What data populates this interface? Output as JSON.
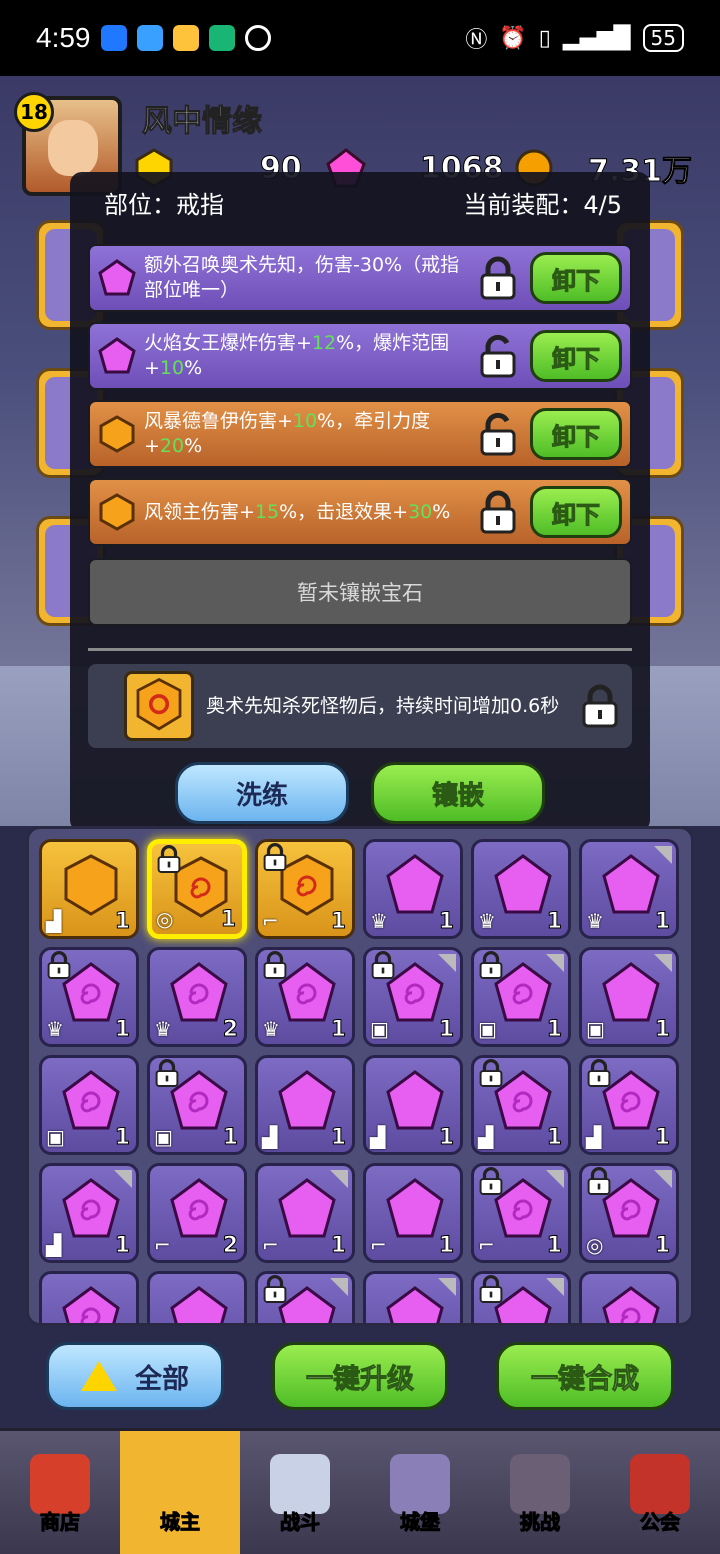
{
  "status_bar": {
    "time": "4:59",
    "battery": "55"
  },
  "header": {
    "player_level": "18",
    "player_name": "风中情缘",
    "gold": "90",
    "diamond": "1068",
    "coins": "7.31万"
  },
  "dialog": {
    "slot_label": "部位：戒指",
    "equip_label": "当前装配：4/5",
    "slots": [
      {
        "type": "purple",
        "text_parts": [
          "额外召唤奥术先知，伤害-30%（戒指部位唯一）"
        ],
        "locked": true,
        "button": "卸下"
      },
      {
        "type": "purple",
        "text_parts": [
          "火焰女王爆炸伤害+",
          "12",
          "%，爆炸范围+",
          "10",
          "%"
        ],
        "locked": false,
        "button": "卸下"
      },
      {
        "type": "orange",
        "text_parts": [
          "风暴德鲁伊伤害+",
          "10",
          "%，牵引力度+",
          "20",
          "%"
        ],
        "locked": false,
        "button": "卸下"
      },
      {
        "type": "orange",
        "text_parts": [
          "风领主伤害+",
          "15",
          "%，击退效果+",
          "30",
          "%"
        ],
        "locked": true,
        "button": "卸下"
      }
    ],
    "empty_slot_text": "暂未镶嵌宝石",
    "detail_text": "奥术先知杀死怪物后，持续时间增加0.6秒",
    "wash_button": "洗练",
    "inlay_button": "镶嵌"
  },
  "inventory": {
    "cells": [
      {
        "color": "gold",
        "shape": "hex",
        "count": "1",
        "part": "boot",
        "lock": false,
        "corner": false,
        "selected": false
      },
      {
        "color": "gold",
        "shape": "hex-swirl",
        "count": "1",
        "part": "ring",
        "lock": true,
        "corner": false,
        "selected": true
      },
      {
        "color": "gold",
        "shape": "hex-swirl",
        "count": "1",
        "part": "staff",
        "lock": true,
        "corner": false,
        "selected": false
      },
      {
        "color": "purple",
        "shape": "pent",
        "count": "1",
        "part": "crown",
        "lock": false,
        "corner": false,
        "selected": false
      },
      {
        "color": "purple",
        "shape": "pent",
        "count": "1",
        "part": "crown",
        "lock": false,
        "corner": false,
        "selected": false
      },
      {
        "color": "purple",
        "shape": "pent",
        "count": "1",
        "part": "crown",
        "lock": false,
        "corner": true,
        "selected": false
      },
      {
        "color": "purple",
        "shape": "pent-swirl",
        "count": "1",
        "part": "crown",
        "lock": true,
        "corner": false,
        "selected": false
      },
      {
        "color": "purple",
        "shape": "pent-swirl",
        "count": "2",
        "part": "crown",
        "lock": false,
        "corner": false,
        "selected": false
      },
      {
        "color": "purple",
        "shape": "pent-swirl",
        "count": "1",
        "part": "crown",
        "lock": true,
        "corner": false,
        "selected": false
      },
      {
        "color": "purple",
        "shape": "pent-swirl",
        "count": "1",
        "part": "armor",
        "lock": true,
        "corner": true,
        "selected": false
      },
      {
        "color": "purple",
        "shape": "pent-swirl",
        "count": "1",
        "part": "armor",
        "lock": true,
        "corner": true,
        "selected": false
      },
      {
        "color": "purple",
        "shape": "pent",
        "count": "1",
        "part": "armor",
        "lock": false,
        "corner": true,
        "selected": false
      },
      {
        "color": "purple",
        "shape": "pent-swirl",
        "count": "1",
        "part": "armor",
        "lock": false,
        "corner": false,
        "selected": false
      },
      {
        "color": "purple",
        "shape": "pent-swirl",
        "count": "1",
        "part": "armor",
        "lock": true,
        "corner": false,
        "selected": false
      },
      {
        "color": "purple",
        "shape": "pent",
        "count": "1",
        "part": "boot",
        "lock": false,
        "corner": false,
        "selected": false
      },
      {
        "color": "purple",
        "shape": "pent",
        "count": "1",
        "part": "boot",
        "lock": false,
        "corner": false,
        "selected": false
      },
      {
        "color": "purple",
        "shape": "pent-swirl",
        "count": "1",
        "part": "boot",
        "lock": true,
        "corner": false,
        "selected": false
      },
      {
        "color": "purple",
        "shape": "pent-swirl",
        "count": "1",
        "part": "boot",
        "lock": true,
        "corner": false,
        "selected": false
      },
      {
        "color": "purple",
        "shape": "pent-swirl",
        "count": "1",
        "part": "boot",
        "lock": false,
        "corner": true,
        "selected": false
      },
      {
        "color": "purple",
        "shape": "pent-swirl",
        "count": "2",
        "part": "staff",
        "lock": false,
        "corner": false,
        "selected": false
      },
      {
        "color": "purple",
        "shape": "pent",
        "count": "1",
        "part": "staff",
        "lock": false,
        "corner": true,
        "selected": false
      },
      {
        "color": "purple",
        "shape": "pent",
        "count": "1",
        "part": "staff",
        "lock": false,
        "corner": false,
        "selected": false
      },
      {
        "color": "purple",
        "shape": "pent-swirl",
        "count": "1",
        "part": "staff",
        "lock": true,
        "corner": true,
        "selected": false
      },
      {
        "color": "purple",
        "shape": "pent-swirl",
        "count": "1",
        "part": "ring",
        "lock": true,
        "corner": true,
        "selected": false
      },
      {
        "color": "purple",
        "shape": "pent-swirl",
        "count": "",
        "part": "",
        "lock": false,
        "corner": false,
        "selected": false
      },
      {
        "color": "purple",
        "shape": "pent",
        "count": "",
        "part": "",
        "lock": false,
        "corner": false,
        "selected": false
      },
      {
        "color": "purple",
        "shape": "pent",
        "count": "",
        "part": "",
        "lock": true,
        "corner": true,
        "selected": false
      },
      {
        "color": "purple",
        "shape": "pent",
        "count": "",
        "part": "",
        "lock": false,
        "corner": true,
        "selected": false
      },
      {
        "color": "purple",
        "shape": "pent",
        "count": "",
        "part": "",
        "lock": true,
        "corner": true,
        "selected": false
      },
      {
        "color": "purple",
        "shape": "pent-swirl",
        "count": "",
        "part": "",
        "lock": false,
        "corner": false,
        "selected": false
      }
    ]
  },
  "actions": {
    "all_label": "全部",
    "upgrade_label": "一键升级",
    "combine_label": "一键合成"
  },
  "nav": {
    "items": [
      {
        "label": "商店",
        "icon": "shop-icon"
      },
      {
        "label": "城主",
        "icon": "crown-icon"
      },
      {
        "label": "战斗",
        "icon": "swords-icon"
      },
      {
        "label": "城堡",
        "icon": "castle-icon"
      },
      {
        "label": "挑战",
        "icon": "monster-icon"
      },
      {
        "label": "公会",
        "icon": "guild-banner-icon"
      }
    ],
    "active": "城主"
  },
  "colors": {
    "accent_green": "#4fbd27",
    "highlight_number": "#64e05a",
    "selected_border": "#ffee00",
    "gold_card": "#f2b530",
    "purple_card": "#7d6bc4"
  }
}
